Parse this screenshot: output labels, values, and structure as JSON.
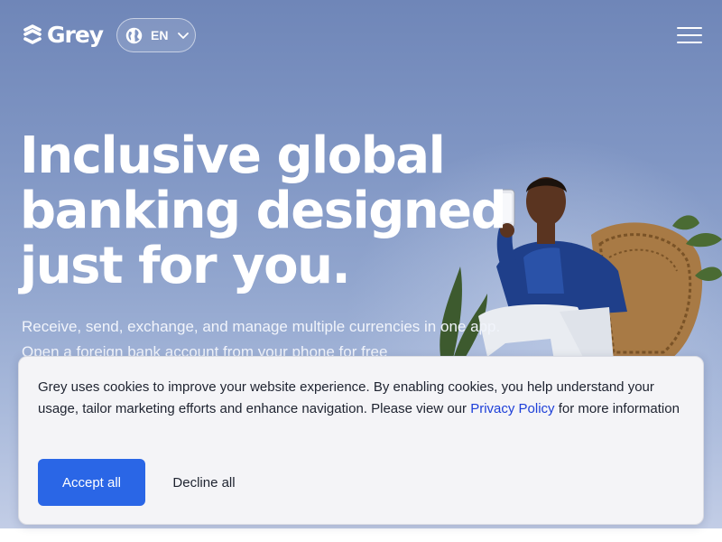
{
  "header": {
    "brand": "Grey",
    "language_code": "EN",
    "icons": {
      "logo": "grey-logo-mark",
      "language": "globe-icon",
      "chevron": "chevron-down-icon",
      "menu": "hamburger-menu-icon"
    }
  },
  "hero": {
    "headline_line1": "Inclusive global",
    "headline_line2": "banking designed",
    "headline_line3": "just for you.",
    "subtitle_line1": "Receive, send, exchange, and manage multiple currencies in one app.",
    "subtitle_line2": "Open a foreign bank account from your phone for free"
  },
  "cookie_banner": {
    "text_before_link": "Grey uses cookies to improve your website experience. By enabling cookies, you help understand your usage, tailor marketing efforts and enhance navigation. Please view our ",
    "link_text": "Privacy Policy",
    "text_after_link": " for more information",
    "accept_label": "Accept all",
    "decline_label": "Decline all"
  },
  "colors": {
    "hero_top": "#6f86b8",
    "hero_bottom": "#c2cde6",
    "accent_button": "#2a66e6",
    "link": "#1d3fd8",
    "banner_bg": "#f4f4f7"
  }
}
